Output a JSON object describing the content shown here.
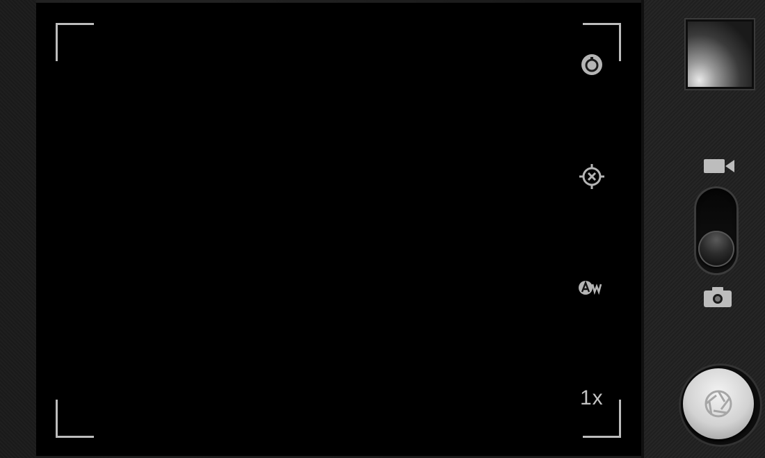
{
  "viewfinder": {
    "zoom_level": "1x",
    "icons": {
      "timer": "timer-icon",
      "focus": "focus-mode-icon",
      "white_balance": "white-balance-auto-icon"
    }
  },
  "controls": {
    "thumbnail": "last-photo-thumbnail",
    "mode_video_icon": "video-camera-icon",
    "mode_photo_icon": "photo-camera-icon",
    "mode_switch_selected": "photo",
    "shutter_icon": "aperture-icon"
  },
  "colors": {
    "viewfinder_bg": "#000000",
    "panel_bg": "#222222",
    "overlay_gray": "#bdbdbd",
    "shutter_face": "#d2d2d2"
  }
}
